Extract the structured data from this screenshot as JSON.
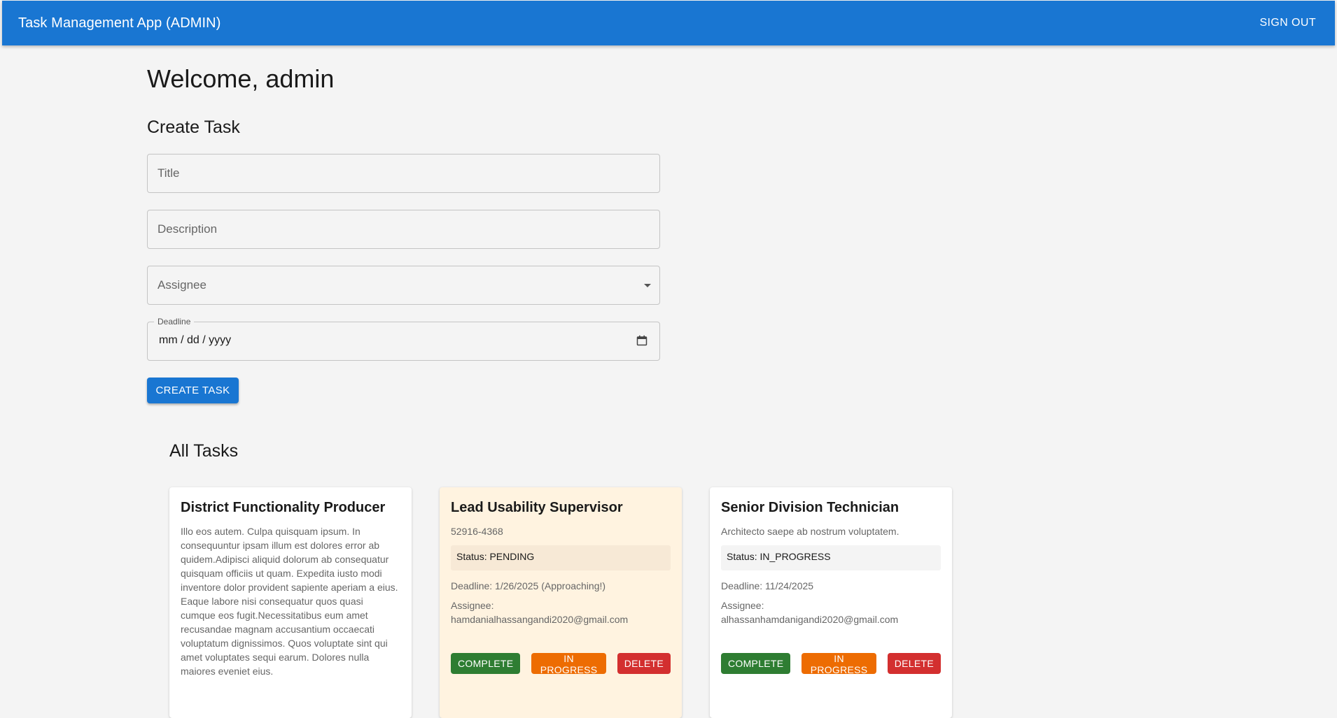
{
  "appbar": {
    "title": "Task Management App (ADMIN)",
    "signout_label": "SIGN OUT"
  },
  "welcome": "Welcome, admin",
  "create_section": {
    "heading": "Create Task",
    "title_placeholder": "Title",
    "description_placeholder": "Description",
    "assignee_placeholder": "Assignee",
    "deadline_label": "Deadline",
    "deadline_value": "mm / dd / yyyy",
    "submit_label": "CREATE TASK"
  },
  "tasks_section": {
    "heading": "All Tasks",
    "tasks": [
      {
        "title": "District Functionality Producer",
        "description": "Illo eos autem. Culpa quisquam ipsum. In consequuntur ipsam illum est dolores error ab quidem.Adipisci aliquid dolorum ab consequatur quisquam officiis ut quam. Expedita iusto modi inventore dolor provident sapiente aperiam a eius. Eaque labore nisi consequatur quos quasi cumque eos fugit.Necessitatibus eum amet recusandae magnam accusantium occaecati voluptatum dignissimos. Quos voluptate sint qui amet voluptates sequi earum. Dolores nulla maiores eveniet eius."
      },
      {
        "title": "Lead Usability Supervisor",
        "description": "52916-4368",
        "status": "Status: PENDING",
        "deadline": "Deadline: 1/26/2025 (Approaching!)",
        "assignee": "Assignee: hamdanialhassangandi2020@gmail.com",
        "actions": {
          "complete": "COMPLETE",
          "in_progress": "IN PROGRESS",
          "delete": "DELETE"
        }
      },
      {
        "title": "Senior Division Technician",
        "description": "Architecto saepe ab nostrum voluptatem.",
        "status": "Status: IN_PROGRESS",
        "deadline": "Deadline: 11/24/2025",
        "assignee": "Assignee: alhassanhamdanigandi2020@gmail.com",
        "actions": {
          "complete": "COMPLETE",
          "in_progress": "IN PROGRESS",
          "delete": "DELETE"
        }
      }
    ]
  },
  "colors": {
    "primary": "#1976d2",
    "complete": "#2e7d32",
    "in_progress": "#ed6c02",
    "delete": "#d32f2f",
    "pending_card": "#fff3e0"
  }
}
